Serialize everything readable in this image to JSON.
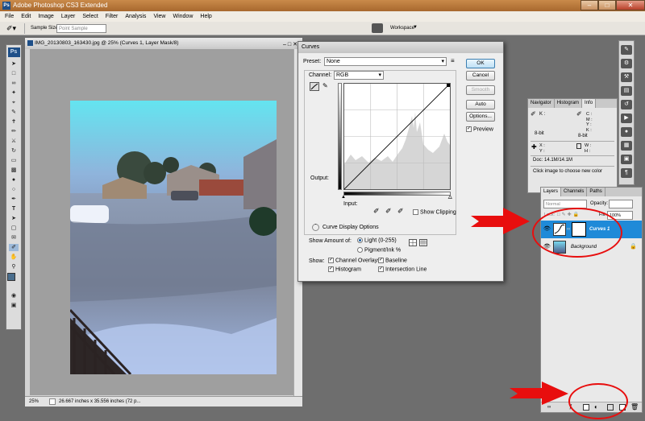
{
  "window": {
    "title": "Adobe Photoshop CS3 Extended",
    "app_icon": "Ps"
  },
  "menu": [
    "File",
    "Edit",
    "Image",
    "Layer",
    "Select",
    "Filter",
    "Analysis",
    "View",
    "Window",
    "Help"
  ],
  "options_bar": {
    "sample_size_label": "Sample Size:",
    "sample_size_value": "Point Sample",
    "workspace_label": "Workspace"
  },
  "document": {
    "title": "IMG_20130803_163430.jpg @ 25% (Curves 1, Layer Mask/8)",
    "zoom": "25%",
    "status": "26.667 inches x 35.556 inches (72 p..."
  },
  "curves": {
    "title": "Curves",
    "preset_label": "Preset:",
    "preset_value": "None",
    "channel_label": "Channel:",
    "channel_value": "RGB",
    "output_label": "Output:",
    "input_label": "Input:",
    "show_clipping": "Show Clipping",
    "display_options": "Curve Display Options",
    "show_amount_label": "Show Amount of:",
    "light_option": "Light  (0-255)",
    "pigment_option": "Pigment/Ink %",
    "show_label": "Show:",
    "channel_overlays": "Channel Overlays",
    "baseline": "Baseline",
    "histogram": "Histogram",
    "intersection_line": "Intersection Line",
    "buttons": {
      "ok": "OK",
      "cancel": "Cancel",
      "smooth": "Smooth",
      "auto": "Auto",
      "options": "Options..."
    },
    "preview_label": "Preview"
  },
  "info_panel": {
    "tabs": [
      "Navigator",
      "Histogram",
      "Info"
    ],
    "active_tab": "Info",
    "k_label": "K :",
    "c_label": "C :",
    "m_label": "M :",
    "y_label": "Y :",
    "x_label": "X :",
    "w_label": "W :",
    "h_label": "H :",
    "bit_left": "8-bit",
    "bit_right": "8-bit",
    "doc_size": "Doc: 14.1M/14.1M",
    "hint": "Click image to choose new color"
  },
  "layers_panel": {
    "tabs": [
      "Layers",
      "Channels",
      "Paths"
    ],
    "blend_mode": "Normal",
    "opacity_label": "Opacity:",
    "opacity_value": "",
    "lock_label": "Lock:",
    "fill_label": "Fill:",
    "fill_value": "100%",
    "layers": [
      {
        "name": "Curves 1",
        "selected": true
      },
      {
        "name": "Background",
        "selected": false
      }
    ]
  },
  "colors": {
    "selected_layer": "#1f8ad8",
    "annotation_red": "#e80e0e",
    "titlebar": "#b87838"
  }
}
